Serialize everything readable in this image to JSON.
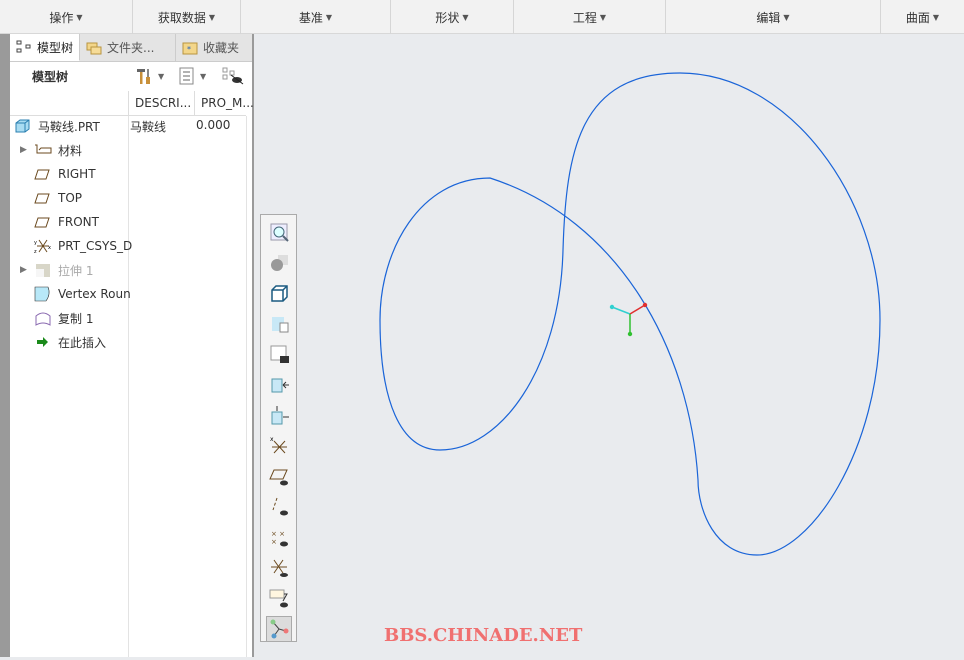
{
  "menubar": [
    {
      "label": "操作"
    },
    {
      "label": "获取数据"
    },
    {
      "label": "基准"
    },
    {
      "label": "形状"
    },
    {
      "label": "工程"
    },
    {
      "label": "编辑"
    },
    {
      "label": "曲面"
    }
  ],
  "tabs": [
    {
      "label": "模型树"
    },
    {
      "label": "文件夹..."
    },
    {
      "label": "收藏夹"
    }
  ],
  "panel": {
    "title": "模型树",
    "columns": [
      "DESCRI...",
      "PRO_M..."
    ]
  },
  "tree": [
    {
      "label": "马鞍线.PRT",
      "desc": "马鞍线",
      "pro": "0.000",
      "icon": "part-icon"
    },
    {
      "label": "材料",
      "icon": "material-icon",
      "expandable": true
    },
    {
      "label": "RIGHT",
      "icon": "datum-plane-icon"
    },
    {
      "label": "TOP",
      "icon": "datum-plane-icon"
    },
    {
      "label": "FRONT",
      "icon": "datum-plane-icon"
    },
    {
      "label": "PRT_CSYS_D",
      "icon": "csys-icon"
    },
    {
      "label": "拉伸 1",
      "icon": "extrude-icon",
      "expandable": true,
      "suppressed": true
    },
    {
      "label": "Vertex Roun",
      "icon": "round-icon"
    },
    {
      "label": "复制 1",
      "icon": "copy-icon"
    },
    {
      "label": "在此插入",
      "icon": "insert-arrow-icon"
    }
  ],
  "viewtools": [
    "zoom-icon",
    "appearance-icon",
    "display-style-icon",
    "saved-views-icon",
    "view-snapshot-icon",
    "view-normal-icon",
    "view-orient-icon",
    "datum-display-icon",
    "plane-display-icon",
    "axis-display-icon",
    "point-display-icon",
    "csys-display-icon",
    "annotation-display-icon",
    "spin-center-icon"
  ],
  "watermark": "BBS.CHINADE.NET",
  "colors": {
    "curve": "#1a64d8",
    "watermark": "#f07070"
  }
}
